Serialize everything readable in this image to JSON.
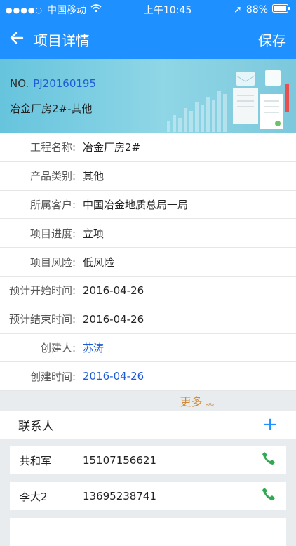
{
  "status_bar": {
    "carrier": "中国移动",
    "time": "上午10:45",
    "battery": "88%"
  },
  "nav": {
    "title": "项目详情",
    "save_label": "保存"
  },
  "hero": {
    "no_label": "NO.",
    "project_no": "PJ20160195",
    "project_name": "冶金厂房2#-其他"
  },
  "fields": [
    {
      "label": "工程名称:",
      "value": "冶金厂房2#"
    },
    {
      "label": "产品类别:",
      "value": "其他"
    },
    {
      "label": "所属客户:",
      "value": "中国冶金地质总局一局"
    },
    {
      "label": "项目进度:",
      "value": "立项"
    },
    {
      "label": "项目风险:",
      "value": "低风险"
    },
    {
      "label": "预计开始时间:",
      "value": "2016-04-26"
    },
    {
      "label": "预计结束时间:",
      "value": "2016-04-26"
    },
    {
      "label": "创建人:",
      "value": "苏涛"
    },
    {
      "label": "创建时间:",
      "value": "2016-04-26"
    }
  ],
  "more_label": "更多",
  "contacts": {
    "header": "联系人",
    "items": [
      {
        "name": "共和军",
        "phone": "15107156621"
      },
      {
        "name": "李大2",
        "phone": "13695238741"
      }
    ]
  },
  "colors": {
    "primary": "#1e90ff",
    "link": "#1e5bd6",
    "accent": "#d08a3a",
    "call": "#32a852"
  }
}
